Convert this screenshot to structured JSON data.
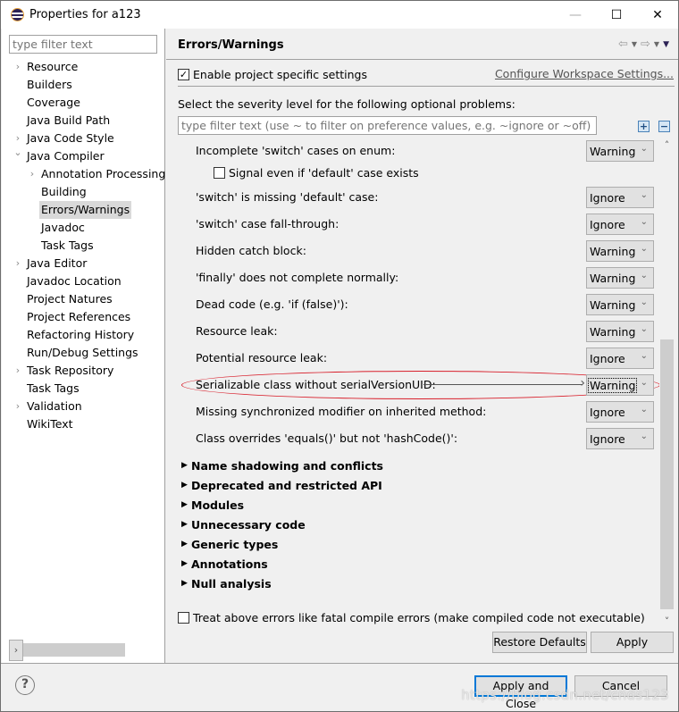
{
  "window": {
    "title": "Properties for a123",
    "controls": {
      "minimize": "—",
      "maximize": "☐",
      "close": "✕"
    }
  },
  "left_pane": {
    "filter_placeholder": "type filter text",
    "tree": [
      {
        "label": "Resource",
        "level": 0,
        "expander": "collapsed"
      },
      {
        "label": "Builders",
        "level": 0,
        "expander": "none"
      },
      {
        "label": "Coverage",
        "level": 0,
        "expander": "none"
      },
      {
        "label": "Java Build Path",
        "level": 0,
        "expander": "none"
      },
      {
        "label": "Java Code Style",
        "level": 0,
        "expander": "collapsed"
      },
      {
        "label": "Java Compiler",
        "level": 0,
        "expander": "expanded"
      },
      {
        "label": "Annotation Processing",
        "level": 1,
        "expander": "collapsed"
      },
      {
        "label": "Building",
        "level": 1,
        "expander": "none"
      },
      {
        "label": "Errors/Warnings",
        "level": 1,
        "expander": "none",
        "selected": true
      },
      {
        "label": "Javadoc",
        "level": 1,
        "expander": "none"
      },
      {
        "label": "Task Tags",
        "level": 1,
        "expander": "none"
      },
      {
        "label": "Java Editor",
        "level": 0,
        "expander": "collapsed"
      },
      {
        "label": "Javadoc Location",
        "level": 0,
        "expander": "none"
      },
      {
        "label": "Project Natures",
        "level": 0,
        "expander": "none"
      },
      {
        "label": "Project References",
        "level": 0,
        "expander": "none"
      },
      {
        "label": "Refactoring History",
        "level": 0,
        "expander": "none"
      },
      {
        "label": "Run/Debug Settings",
        "level": 0,
        "expander": "none"
      },
      {
        "label": "Task Repository",
        "level": 0,
        "expander": "collapsed"
      },
      {
        "label": "Task Tags",
        "level": 0,
        "expander": "none"
      },
      {
        "label": "Validation",
        "level": 0,
        "expander": "collapsed"
      },
      {
        "label": "WikiText",
        "level": 0,
        "expander": "none"
      }
    ]
  },
  "page": {
    "title": "Errors/Warnings",
    "nav": {
      "back": "⇦",
      "forward": "⇨",
      "dropdown": "▼",
      "menu": "▼"
    },
    "enable_specific": {
      "label": "Enable project specific settings",
      "checked": true
    },
    "configure_link": "Configure Workspace Settings...",
    "severity_label": "Select the severity level for the following optional problems:",
    "filter_placeholder": "type filter text (use ~ to filter on preference values, e.g. ~ignore or ~off)",
    "expand_all": "+",
    "collapse_all": "−",
    "options": [
      {
        "label": "Incomplete 'switch' cases on enum:",
        "value": "Warning"
      },
      {
        "sub_checkbox": "Signal even if 'default' case exists",
        "checked": false
      },
      {
        "label": "'switch' is missing 'default' case:",
        "value": "Ignore"
      },
      {
        "label": "'switch' case fall-through:",
        "value": "Ignore"
      },
      {
        "label": "Hidden catch block:",
        "value": "Warning"
      },
      {
        "label": "'finally' does not complete normally:",
        "value": "Warning"
      },
      {
        "label": "Dead code (e.g. 'if (false)'):",
        "value": "Warning"
      },
      {
        "label": "Resource leak:",
        "value": "Warning"
      },
      {
        "label": "Potential resource leak:",
        "value": "Ignore"
      },
      {
        "label": "Serializable class without serialVersionUID:",
        "value": "Warning",
        "highlighted": true
      },
      {
        "label": "Missing synchronized modifier on inherited method:",
        "value": "Ignore"
      },
      {
        "label": "Class overrides 'equals()' but not 'hashCode()':",
        "value": "Ignore"
      }
    ],
    "sections": [
      "Name shadowing and conflicts",
      "Deprecated and restricted API",
      "Modules",
      "Unnecessary code",
      "Generic types",
      "Annotations",
      "Null analysis"
    ],
    "fatal_errors": {
      "label": "Treat above errors like fatal compile errors (make compiled code not executable)",
      "checked": false
    },
    "restore_defaults": "Restore Defaults",
    "apply": "Apply"
  },
  "footer": {
    "help": "?",
    "apply_and_close": "Apply and Close",
    "cancel": "Cancel",
    "watermark": "https://blog.csdn.net/cnds123"
  }
}
